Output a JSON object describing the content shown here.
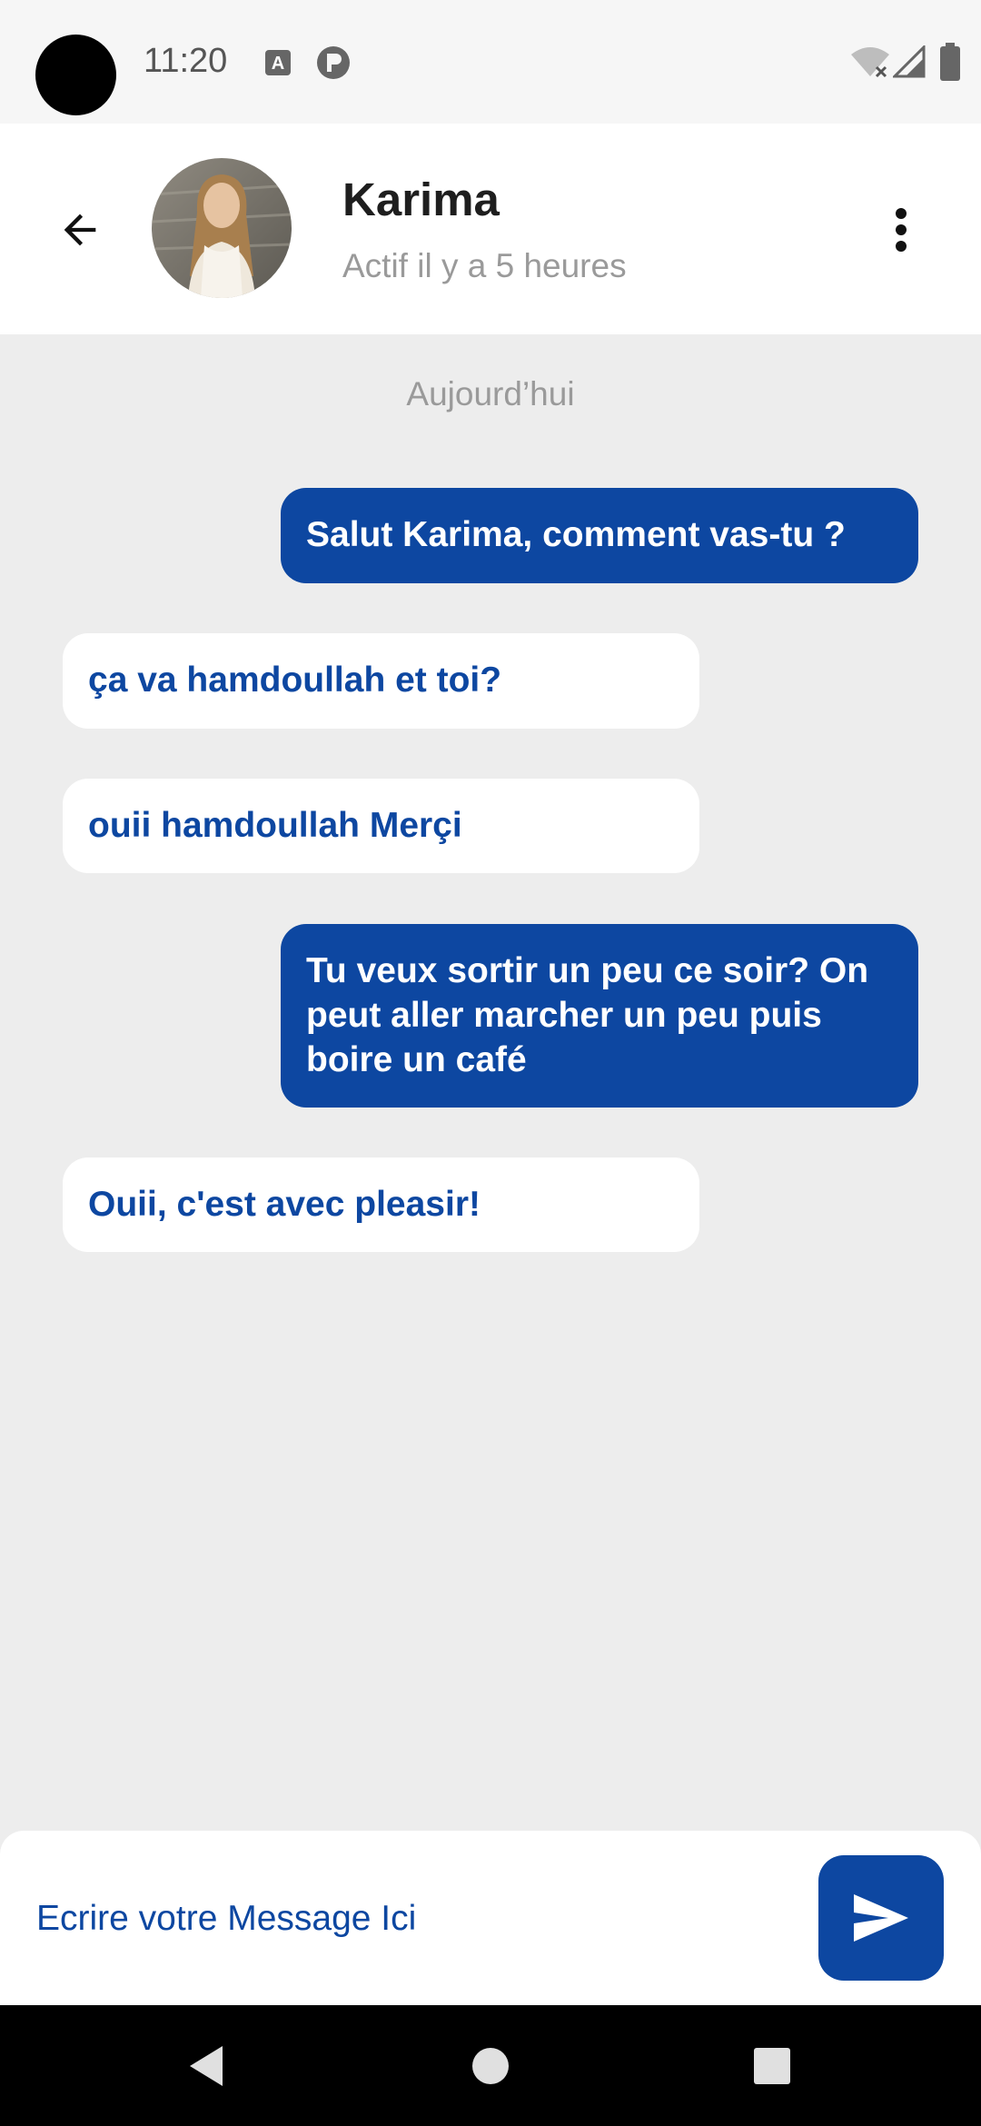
{
  "status_bar": {
    "time": "11:20",
    "icons": [
      "font-notification-icon",
      "app-notification-icon",
      "wifi-off-icon",
      "signal-icon",
      "battery-icon"
    ]
  },
  "header": {
    "contact_name": "Karima",
    "contact_status": "Actif il y a 5 heures",
    "icons": [
      "arrow-back-icon",
      "more-vert-icon"
    ]
  },
  "chat": {
    "date_separator": "Aujourd’hui",
    "messages": [
      {
        "direction": "sent",
        "lines": [
          "Salut Karima, comment vas-tu ?"
        ]
      },
      {
        "direction": "received",
        "lines": [
          "ça va hamdoullah et toi?"
        ]
      },
      {
        "direction": "received",
        "lines": [
          "ouii hamdoullah Merçi"
        ]
      },
      {
        "direction": "sent",
        "lines": [
          "Tu veux sortir un peu ce soir? On",
          "peut aller marcher un peu puis",
          "boire un café"
        ]
      },
      {
        "direction": "received",
        "lines": [
          "Ouii, c'est avec pleasir!"
        ]
      }
    ]
  },
  "composer": {
    "placeholder": "Ecrire votre Message Ici",
    "value": "",
    "send_icon": "send-icon"
  },
  "colors": {
    "accent": "#0d47a1",
    "chat_background": "#ededed",
    "muted_text": "#9a9a9a"
  },
  "nav_bar": {
    "icons": [
      "nav-back-icon",
      "nav-home-icon",
      "nav-recents-icon"
    ]
  }
}
